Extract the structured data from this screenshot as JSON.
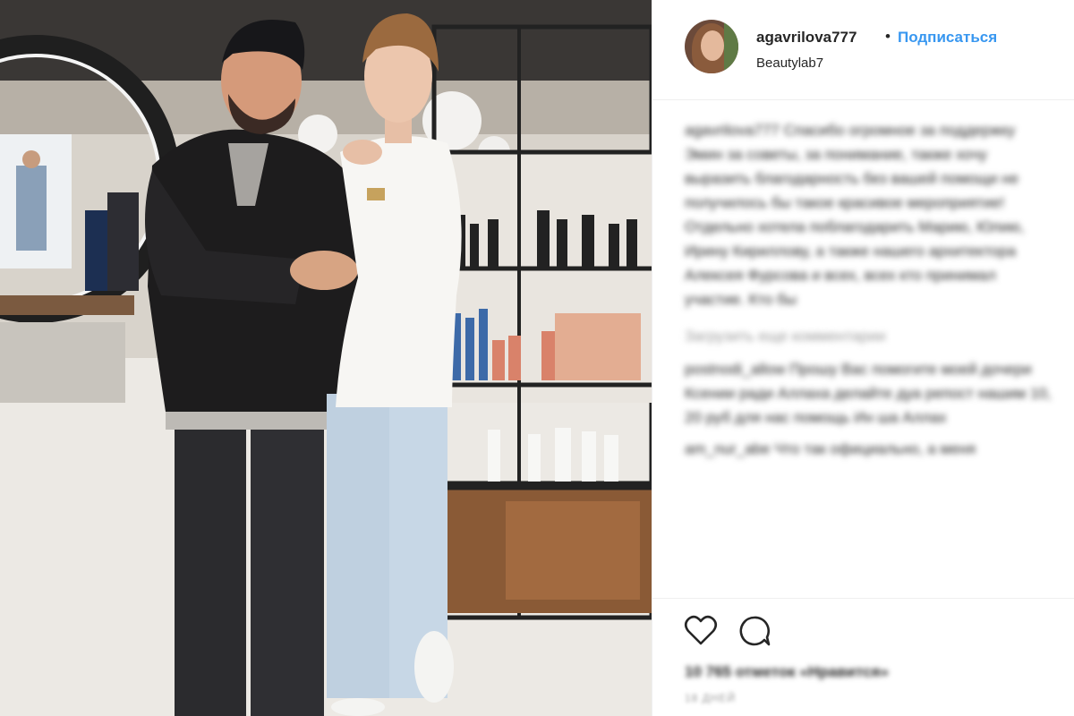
{
  "post": {
    "username": "agavrilova777",
    "separator": "•",
    "follow_label": "Подписаться",
    "location": "Beautylab7"
  },
  "comments": {
    "caption_author": "agavrilova777",
    "caption_text": "Спасибо огромное за поддержку Эмин за советы, за понимание, также хочу выразить благодарность без вашей помощи не получилось бы такое красивое мероприятие! Отдельно хотела поблагодарить Марию, Юлию, Ирину Кириллову, а также нашего архитектора Алексея Фурсова и всех, всех кто принимал участие. Кто бы",
    "load_more": "Загрузить еще комментарии",
    "comment1_author": "postnodi_allow",
    "comment1_text": "Прошу Вас помогите моей дочери Ксении ради Аллаха делайте дуа репост нашим 10, 20 руб для нас помощь Ин ша Аллах",
    "comment2_author": "am_nur_abe",
    "comment2_text": "Что так официально, а меня"
  },
  "actions": {
    "likes_text": "10 765 отметок «Нравится»",
    "date_text": "18 ДНЕЙ"
  }
}
